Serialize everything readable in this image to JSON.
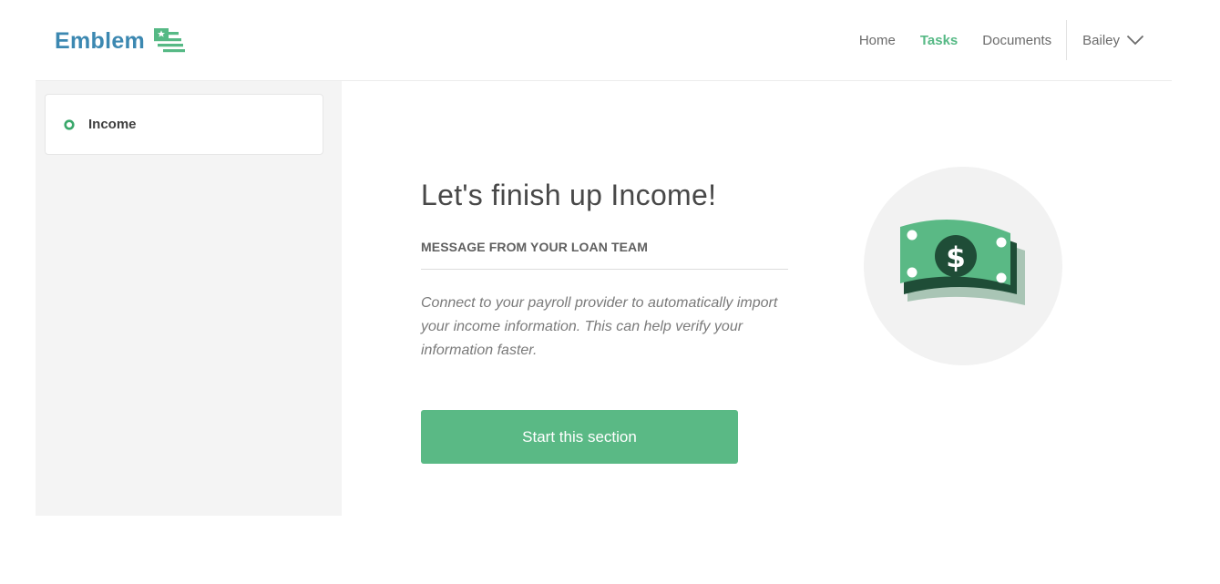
{
  "brand": {
    "name": "Emblem",
    "logo_icon": "flag-icon",
    "color": "#3c88b1",
    "accent": "#56b985"
  },
  "nav": {
    "links": [
      {
        "label": "Home",
        "active": false
      },
      {
        "label": "Tasks",
        "active": true
      },
      {
        "label": "Documents",
        "active": false
      }
    ],
    "user": {
      "name": "Bailey",
      "icon": "chevron-down-icon"
    }
  },
  "sidebar": {
    "items": [
      {
        "label": "Income",
        "icon": "status-ring-icon"
      }
    ]
  },
  "main": {
    "title": "Let's finish up Income!",
    "subheading": "MESSAGE FROM YOUR LOAN TEAM",
    "message": "Connect to your payroll provider to automatically import your income information. This can help verify your information faster.",
    "button_label": "Start this section",
    "illustration_icon": "money-icon"
  }
}
